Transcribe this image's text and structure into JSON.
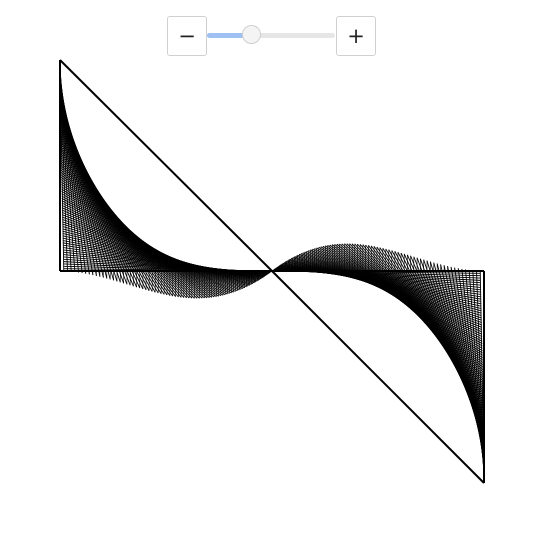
{
  "controls": {
    "decrement_label": "−",
    "increment_label": "+",
    "slider_level": 0.35
  },
  "colors": {
    "slider_fill": "#9fc0f3",
    "slider_track": "#e6e6e6",
    "line_color": "#000000"
  },
  "icons": {
    "decrement": "minus-icon",
    "increment": "plus-icon"
  }
}
